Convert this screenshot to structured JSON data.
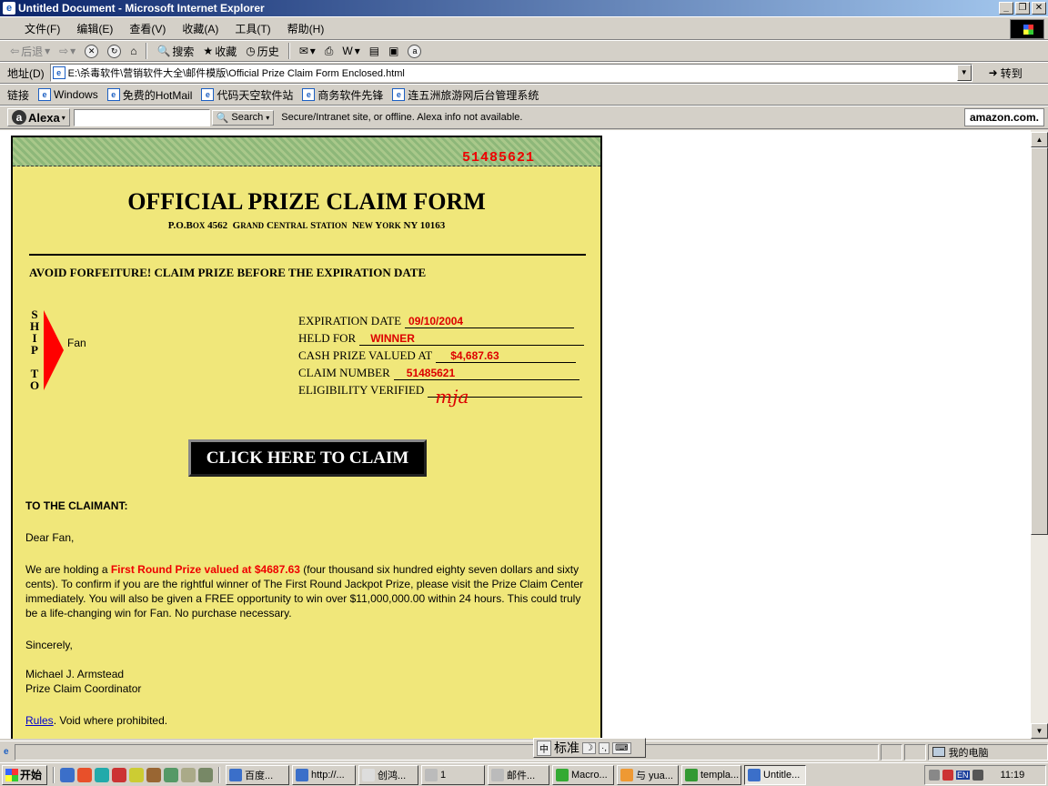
{
  "window": {
    "title": "Untitled Document - Microsoft Internet Explorer"
  },
  "menu": [
    "文件(F)",
    "编辑(E)",
    "查看(V)",
    "收藏(A)",
    "工具(T)",
    "帮助(H)"
  ],
  "toolbar": {
    "back": "后退",
    "search": "搜索",
    "favorites": "收藏",
    "history": "历史"
  },
  "address": {
    "label": "地址(D)",
    "url": "E:\\杀毒软件\\营销软件大全\\邮件模版\\Official Prize Claim Form Enclosed.html",
    "go": "转到"
  },
  "links": {
    "label": "链接",
    "items": [
      "Windows",
      "免费的HotMail",
      "代码天空软件站",
      "商务软件先锋",
      "连五洲旅游网后台管理系统"
    ]
  },
  "alexa": {
    "brand": "Alexa",
    "search": "Search",
    "status": "Secure/Intranet site, or offline. Alexa info not available.",
    "amazon": "amazon.com."
  },
  "form": {
    "serial": "51485621",
    "title": "OFFICIAL PRIZE CLAIM FORM",
    "address": "P.O.Box 4562  Grand Central Station  New York NY 10163",
    "avoid": "AVOID FORFEITURE! CLAIM PRIZE BEFORE THE EXPIRATION DATE",
    "ship_to": [
      "S",
      "H",
      "I",
      "P",
      "",
      "T",
      "O"
    ],
    "recipient": "Fan",
    "fields": [
      {
        "label": "EXPIRATION DATE",
        "value": "09/10/2004"
      },
      {
        "label": "HELD FOR",
        "value": "WINNER"
      },
      {
        "label": "CASH PRIZE VALUED AT",
        "value": "$4,687.63"
      },
      {
        "label": "CLAIM NUMBER",
        "value": "51485621"
      },
      {
        "label": "ELIGIBILITY VERIFIED",
        "value": "mja"
      }
    ],
    "claim_button": "CLICK HERE TO CLAIM",
    "to_claimant": "TO THE CLAIMANT:",
    "greeting": "Dear Fan,",
    "body_pre": "We are holding a ",
    "body_highlight": "First Round Prize valued at $4687.63",
    "body_post": " (four thousand six hundred eighty seven dollars and sixty cents). To confirm if you are the rightful winner of The First Round Jackpot Prize, please visit the Prize Claim Center immediately. You will also be given a FREE opportunity to win over $11,000,000.00 within 24 hours. This could truly be a life-changing win for Fan. No purchase necessary.",
    "closing": "Sincerely,",
    "signer_name": "Michael J. Armstead",
    "signer_title": "Prize Claim Coordinator",
    "rules_link": "Rules",
    "rules_suffix": ". Void where prohibited."
  },
  "statusbar": {
    "zone": "我的电脑"
  },
  "ime": {
    "mode": "标准"
  },
  "taskbar": {
    "start": "开始",
    "tasks": [
      "百度...",
      "http://...",
      "创鸿...",
      "1",
      "邮件...",
      "Macro...",
      "与 yua...",
      "templa...",
      "Untitle..."
    ],
    "lang": "EN",
    "clock": "11:19"
  }
}
